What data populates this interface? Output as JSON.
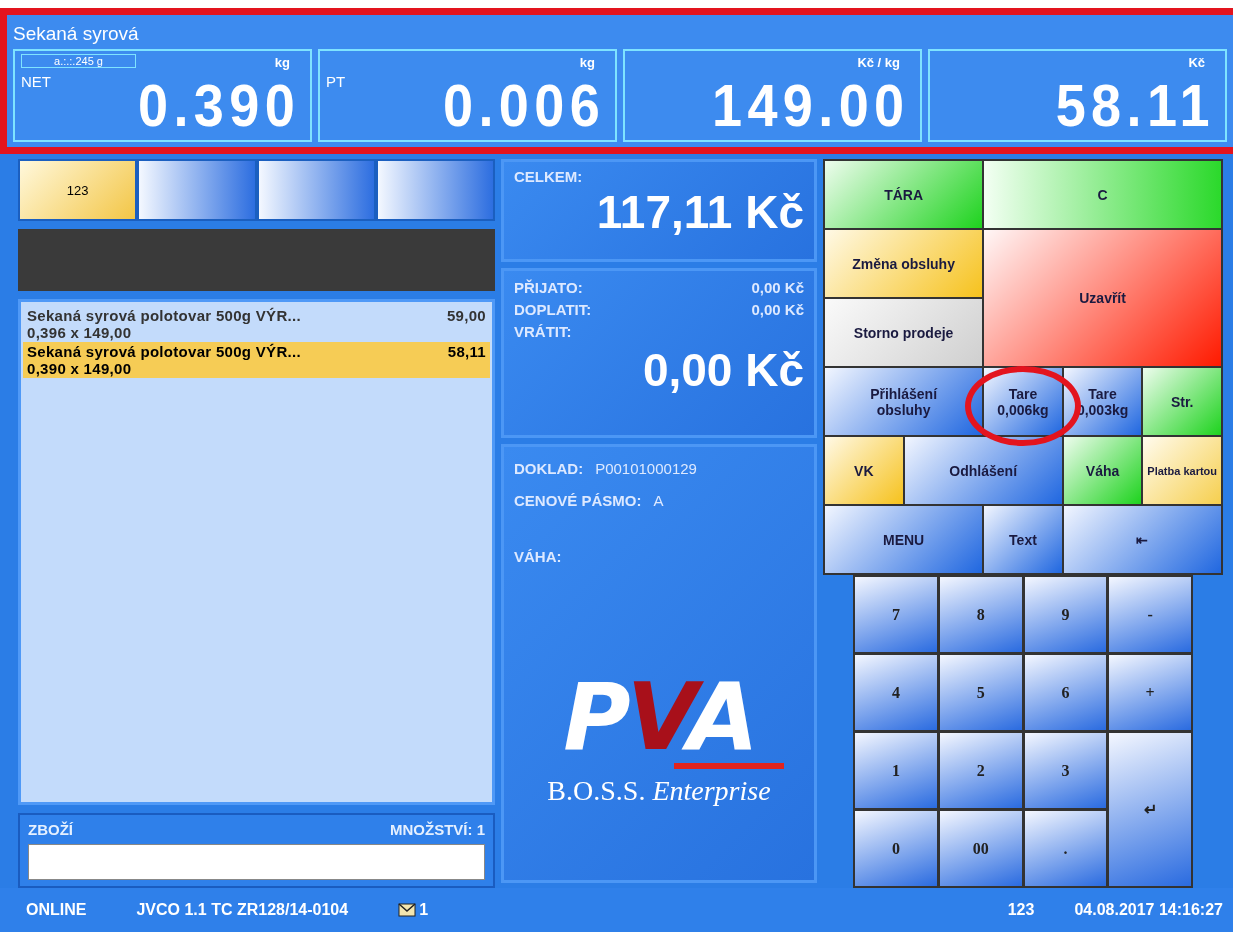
{
  "scale": {
    "product": "Sekaná syrová",
    "highlighted": true,
    "displays": [
      {
        "tag": "a.:.:.245 g",
        "label": "NET",
        "unit": "kg",
        "value": "0.390"
      },
      {
        "label": "PT",
        "unit": "kg",
        "value": "0.006"
      },
      {
        "unit": "Kč / kg",
        "value": "149.00"
      },
      {
        "unit": "Kč",
        "value": "58.11"
      }
    ]
  },
  "tabs": [
    {
      "label": "123",
      "selected": true
    },
    {
      "selected": false
    },
    {
      "selected": false
    },
    {
      "selected": false
    }
  ],
  "items": [
    {
      "name": "Sekaná syrová polotovar 500g VÝR...",
      "price": "59,00",
      "qty": "0,396 x 149,00",
      "selected": false
    },
    {
      "name": "Sekaná syrová polotovar 500g VÝR...",
      "price": "58,11",
      "qty": "0,390 x 149,00",
      "selected": true
    }
  ],
  "entry": {
    "label": "ZBOŽÍ",
    "quantity": "MNOŽSTVÍ: 1"
  },
  "total": {
    "label": "CELKEM:",
    "value": "117,11 Kč"
  },
  "payment": {
    "rows": [
      {
        "label": "PŘIJATO:",
        "value": "0,00 Kč"
      },
      {
        "label": "DOPLATIT:",
        "value": "0,00 Kč"
      },
      {
        "label": "VRÁTIT:"
      }
    ],
    "change": "0,00 Kč"
  },
  "receipt": {
    "rows": [
      {
        "label": "DOKLAD:",
        "value": "P00101000129"
      },
      {
        "label": "CENOVÉ PÁSMO:",
        "value": "A"
      },
      {
        "label": "VÁHA:"
      }
    ],
    "logo": "PVA",
    "tagline": "B.O.S.S. *Enterprise*"
  },
  "functions": [
    {
      "label": "TÁRA",
      "kind": "green"
    },
    {
      "label": "C",
      "kind": "lightgreen"
    },
    {
      "label": "Změna obsluhy",
      "kind": "yellow"
    },
    {
      "label": "Uzavřít",
      "kind": "red"
    },
    {
      "label": "Storno prodeje",
      "kind": "grey"
    },
    {
      "label": "Přihlášení obsluhy",
      "kind": "blue"
    },
    {
      "label": "Tare 0,006kg",
      "kind": "blue",
      "highlighted": true
    },
    {
      "label": "Tare 0,003kg",
      "kind": "blue",
      "highlighted": false
    },
    {
      "label": "Str.",
      "kind": "green"
    },
    {
      "label": "VK",
      "kind": "yellow"
    },
    {
      "label": "Odhlášení",
      "kind": "blue"
    },
    {
      "label": "Váha",
      "kind": "green"
    },
    {
      "label": "Platba kartou",
      "kind": "cream"
    },
    {
      "label": "MENU",
      "kind": "blue"
    },
    {
      "label": "Text",
      "kind": "blue"
    },
    {
      "label": "⇤",
      "kind": "blue"
    }
  ],
  "keypad": [
    {
      "label": "7"
    },
    {
      "label": "8"
    },
    {
      "label": "9"
    },
    {
      "label": "-"
    },
    {
      "label": "4"
    },
    {
      "label": "5"
    },
    {
      "label": "6"
    },
    {
      "label": "+"
    },
    {
      "label": "1"
    },
    {
      "label": "2"
    },
    {
      "label": "3"
    },
    {
      "label": "↵"
    },
    {
      "label": "0"
    },
    {
      "label": "00"
    },
    {
      "label": "."
    }
  ],
  "status_bar": {
    "connection": "ONLINE",
    "device": "JVCO 1.1 TC ZR128/14-0104",
    "messages": "1",
    "user": "123",
    "datetime": "04.08.2017 14:16:27"
  }
}
